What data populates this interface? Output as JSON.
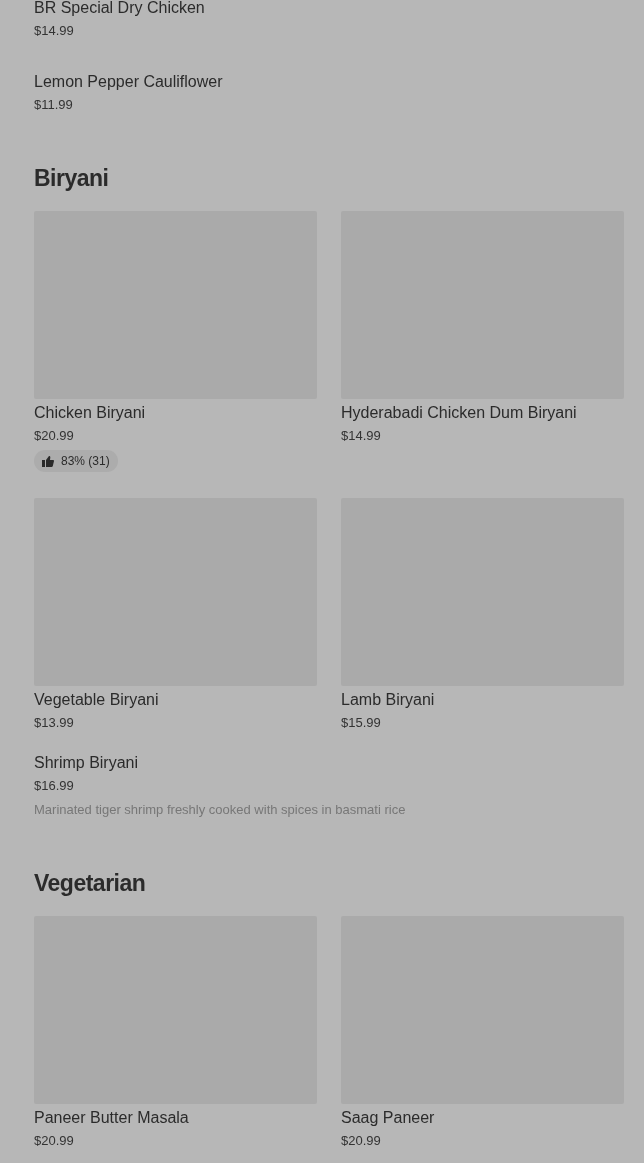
{
  "sections": [
    {
      "items": [
        {
          "kind": "row",
          "name": "BR Special Dry Chicken",
          "price": "$14.99"
        },
        {
          "kind": "row",
          "name": "Lemon Pepper Cauliflower",
          "price": "$11.99"
        }
      ]
    },
    {
      "title": "Biryani",
      "items": [
        {
          "kind": "card",
          "name": "Chicken Biryani",
          "price": "$20.99",
          "rating": "83% (31)"
        },
        {
          "kind": "card",
          "name": "Hyderabadi Chicken Dum Biryani",
          "price": "$14.99"
        },
        {
          "kind": "card",
          "name": "Vegetable Biryani",
          "price": "$13.99"
        },
        {
          "kind": "card",
          "name": "Lamb Biryani",
          "price": "$15.99"
        },
        {
          "kind": "row",
          "name": "Shrimp Biryani",
          "price": "$16.99",
          "description": "Marinated tiger shrimp freshly cooked with spices in basmati rice"
        }
      ]
    },
    {
      "title": "Vegetarian",
      "items": [
        {
          "kind": "card",
          "name": "Paneer Butter Masala",
          "price": "$20.99"
        },
        {
          "kind": "card",
          "name": "Saag Paneer",
          "price": "$20.99"
        }
      ]
    }
  ]
}
